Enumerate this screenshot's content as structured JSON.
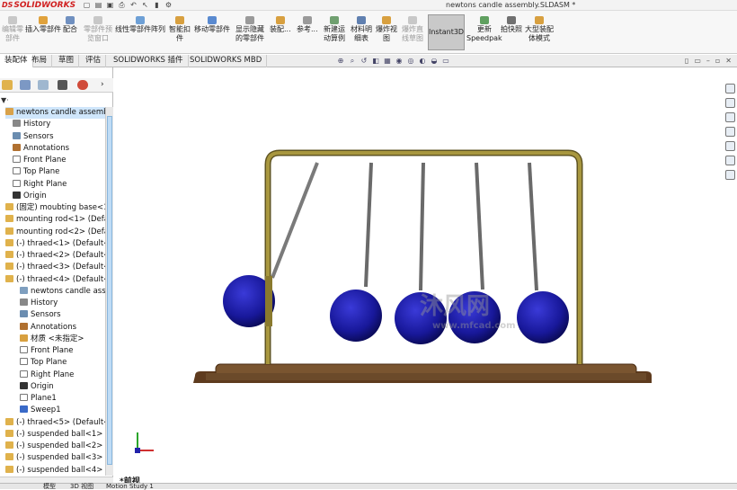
{
  "app": {
    "logo": "SOLIDWORKS",
    "logo_prefix": "DS",
    "title": "newtons candle assembly.SLDASM *"
  },
  "ribbon": [
    {
      "label": "编辑零\n部件",
      "dim": true,
      "icon": "edit-component-icon"
    },
    {
      "label": "插入零部件",
      "dim": false,
      "icon": "insert-component-icon"
    },
    {
      "label": "配合",
      "dim": false,
      "icon": "mate-icon"
    },
    {
      "label": "零部件预\n览窗口",
      "dim": true,
      "icon": "preview-icon"
    },
    {
      "label": "线性零部件阵列",
      "dim": false,
      "icon": "linear-pattern-icon"
    },
    {
      "label": "智能扣\n件",
      "dim": false,
      "icon": "smart-fastener-icon"
    },
    {
      "label": "移动零部件",
      "dim": false,
      "icon": "move-component-icon"
    },
    {
      "label": "显示隐藏\n的零部件",
      "dim": false,
      "icon": "show-hidden-icon"
    },
    {
      "label": "装配...",
      "dim": false,
      "icon": "assembly-features-icon"
    },
    {
      "label": "参考...",
      "dim": false,
      "icon": "reference-geometry-icon"
    },
    {
      "label": "新建运\n动算例",
      "dim": false,
      "icon": "motion-study-icon"
    },
    {
      "label": "材料明\n细表",
      "dim": false,
      "icon": "bom-icon"
    },
    {
      "label": "爆炸视\n图",
      "dim": false,
      "icon": "exploded-view-icon"
    },
    {
      "label": "爆炸直\n线草图",
      "dim": true,
      "icon": "explode-line-icon"
    },
    {
      "label": "Instant3D",
      "dim": false,
      "active": true,
      "icon": "instant3d-icon"
    },
    {
      "label": "更新\nSpeedpak",
      "dim": false,
      "icon": "speedpak-icon"
    },
    {
      "label": "拍快照",
      "dim": false,
      "icon": "snapshot-icon"
    },
    {
      "label": "大型装配\n体模式",
      "dim": false,
      "icon": "large-assembly-icon"
    }
  ],
  "tabs": [
    "装配体",
    "布局",
    "草图",
    "评估",
    "SOLIDWORKS 插件",
    "SOLIDWORKS MBD"
  ],
  "tree": [
    {
      "label": "newtons candle assembly",
      "indent": 0,
      "icon": "assembly-icon",
      "selected": true
    },
    {
      "label": "History",
      "indent": 1,
      "icon": "history-icon"
    },
    {
      "label": "Sensors",
      "indent": 1,
      "icon": "sensor-icon"
    },
    {
      "label": "Annotations",
      "indent": 1,
      "icon": "annotation-icon"
    },
    {
      "label": "Front Plane",
      "indent": 1,
      "icon": "plane-icon"
    },
    {
      "label": "Top Plane",
      "indent": 1,
      "icon": "plane-icon"
    },
    {
      "label": "Right Plane",
      "indent": 1,
      "icon": "plane-icon"
    },
    {
      "label": "Origin",
      "indent": 1,
      "icon": "origin-icon"
    },
    {
      "label": "(固定) moubting base<1",
      "indent": 0,
      "icon": "part-icon"
    },
    {
      "label": "mounting rod<1> (Defa",
      "indent": 0,
      "icon": "part-icon"
    },
    {
      "label": "mounting rod<2> (Defa",
      "indent": 0,
      "icon": "part-icon"
    },
    {
      "label": "(-) thraed<1> (Default<",
      "indent": 0,
      "icon": "part-icon"
    },
    {
      "label": "(-) thraed<2> (Default<",
      "indent": 0,
      "icon": "part-icon"
    },
    {
      "label": "(-) thraed<3> (Default<",
      "indent": 0,
      "icon": "part-icon"
    },
    {
      "label": "(-) thraed<4> (Default<",
      "indent": 0,
      "icon": "part-icon"
    },
    {
      "label": "newtons candle asse",
      "indent": 2,
      "icon": "subassembly-icon"
    },
    {
      "label": "History",
      "indent": 2,
      "icon": "history-icon"
    },
    {
      "label": "Sensors",
      "indent": 2,
      "icon": "sensor-icon"
    },
    {
      "label": "Annotations",
      "indent": 2,
      "icon": "annotation-icon"
    },
    {
      "label": "材质 <未指定>",
      "indent": 2,
      "icon": "material-icon"
    },
    {
      "label": "Front Plane",
      "indent": 2,
      "icon": "plane-icon"
    },
    {
      "label": "Top Plane",
      "indent": 2,
      "icon": "plane-icon"
    },
    {
      "label": "Right Plane",
      "indent": 2,
      "icon": "plane-icon"
    },
    {
      "label": "Origin",
      "indent": 2,
      "icon": "origin-icon"
    },
    {
      "label": "Plane1",
      "indent": 2,
      "icon": "plane-icon"
    },
    {
      "label": "Sweep1",
      "indent": 2,
      "icon": "sweep-icon"
    },
    {
      "label": "(-) thraed<5> (Default<",
      "indent": 0,
      "icon": "part-icon"
    },
    {
      "label": "(-) suspended ball<1> (",
      "indent": 0,
      "icon": "part-icon"
    },
    {
      "label": "(-) suspended ball<2> (",
      "indent": 0,
      "icon": "part-icon"
    },
    {
      "label": "(-) suspended ball<3> (",
      "indent": 0,
      "icon": "part-icon"
    },
    {
      "label": "(-) suspended ball<4> (",
      "indent": 0,
      "icon": "part-icon"
    }
  ],
  "viewport": {
    "view_label": "*前视",
    "watermark": "沐风网",
    "watermark_url": "www.mfcad.com"
  },
  "bottom_tabs": [
    "模型",
    "3D 视图",
    "Motion Study 1"
  ],
  "colors": {
    "ball": "#1a1a9e",
    "frame": "#8a7a2e",
    "base": "#6b4a2a",
    "accent": "#d01f1f"
  }
}
